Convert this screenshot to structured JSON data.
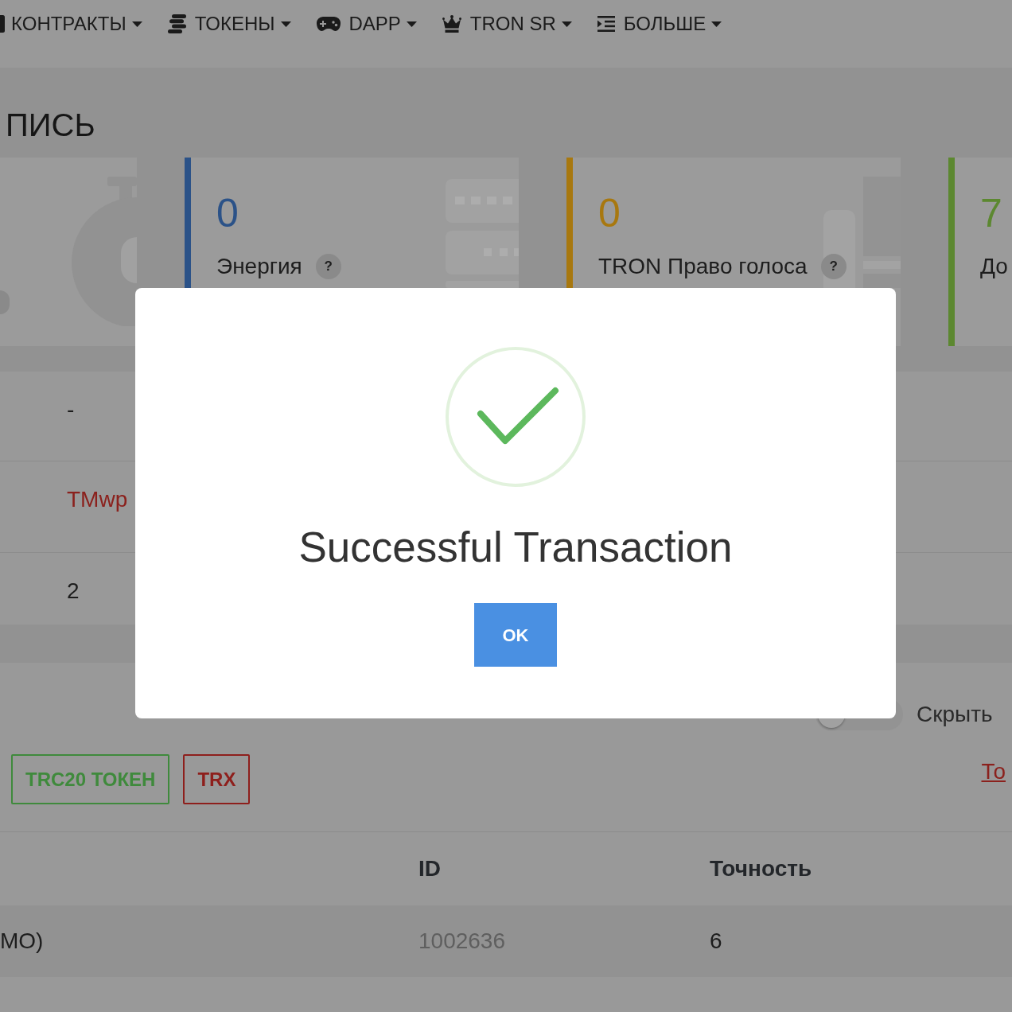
{
  "nav": {
    "items": [
      {
        "label": "КОНТРАКТЫ"
      },
      {
        "label": "ТОКЕНЫ"
      },
      {
        "label": "DAPP"
      },
      {
        "label": "TRON SR"
      },
      {
        "label": "БОЛЬШЕ"
      }
    ]
  },
  "page_title": "ПИСЬ",
  "stats": [
    {
      "value": "0",
      "label": "Энергия",
      "help": "?",
      "color": "#2b5288"
    },
    {
      "value": "0",
      "label": "TRON Право голоса",
      "help": "?",
      "color": "#a8780f"
    },
    {
      "value": "7",
      "label": "До",
      "color": "#5c8830"
    }
  ],
  "details": [
    {
      "kind": "text",
      "value": "-"
    },
    {
      "kind": "link",
      "value": "TMwp"
    },
    {
      "kind": "text",
      "value": "2"
    }
  ],
  "hide_toggle": {
    "label": "Скрыть",
    "on": false
  },
  "filters": [
    {
      "label": "TRC20 ТОКЕН",
      "color": "#3f8a3c"
    },
    {
      "label": "TRX",
      "color": "#8e1f1c"
    }
  ],
  "side_link": "То",
  "tokens_table": {
    "columns": [
      "ID",
      "Точность"
    ],
    "rows": [
      {
        "column_1": "МО)",
        "cells": [
          "1002636",
          "6"
        ]
      }
    ]
  },
  "modal": {
    "title": "Successful Transaction",
    "button": "OK"
  }
}
